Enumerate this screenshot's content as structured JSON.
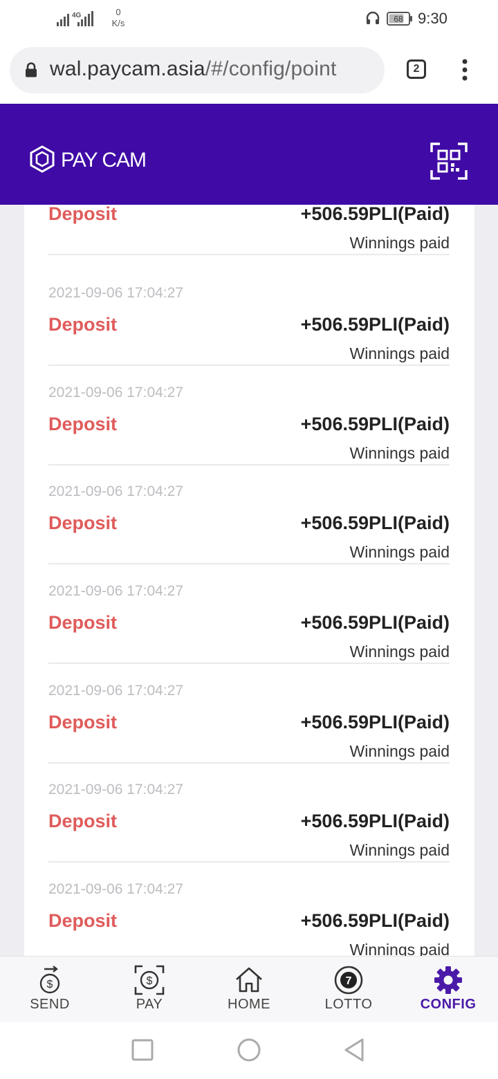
{
  "status": {
    "network": "4G",
    "speed_value": "0",
    "speed_unit": "K/s",
    "battery": "68",
    "time": "9:30"
  },
  "browser": {
    "url_domain": "wal.paycam.asia",
    "url_path": "/#/config/point",
    "tab_count": "2"
  },
  "header": {
    "brand": "PAY CAM"
  },
  "entries": [
    {
      "date": "",
      "type": "Deposit",
      "amount": "+506.59PLI(Paid)",
      "note": "Winnings paid"
    },
    {
      "date": "2021-09-06 17:04:27",
      "type": "Deposit",
      "amount": "+506.59PLI(Paid)",
      "note": "Winnings paid"
    },
    {
      "date": "2021-09-06 17:04:27",
      "type": "Deposit",
      "amount": "+506.59PLI(Paid)",
      "note": "Winnings paid"
    },
    {
      "date": "2021-09-06 17:04:27",
      "type": "Deposit",
      "amount": "+506.59PLI(Paid)",
      "note": "Winnings paid"
    },
    {
      "date": "2021-09-06 17:04:27",
      "type": "Deposit",
      "amount": "+506.59PLI(Paid)",
      "note": "Winnings paid"
    },
    {
      "date": "2021-09-06 17:04:27",
      "type": "Deposit",
      "amount": "+506.59PLI(Paid)",
      "note": "Winnings paid"
    },
    {
      "date": "2021-09-06 17:04:27",
      "type": "Deposit",
      "amount": "+506.59PLI(Paid)",
      "note": "Winnings paid"
    },
    {
      "date": "2021-09-06 17:04:27",
      "type": "Deposit",
      "amount": "+506.59PLI(Paid)",
      "note": "Winnings paid"
    }
  ],
  "nav": {
    "send": "SEND",
    "pay": "PAY",
    "home": "HOME",
    "lotto": "LOTTO",
    "lotto_badge": "7",
    "config": "CONFIG",
    "active": "config"
  },
  "colors": {
    "brand_purple": "#3f0aa5",
    "deposit_red": "#e05b5b",
    "active_nav": "#4a1aa8"
  },
  "icons": [
    "signal-icon",
    "headset-icon",
    "battery-icon",
    "lock-icon",
    "more-vert-icon",
    "paycam-logo-icon",
    "qr-scan-icon",
    "send-icon",
    "pay-icon",
    "home-icon",
    "lotto-icon",
    "gear-icon",
    "square-icon",
    "circle-icon",
    "back-triangle-icon"
  ]
}
